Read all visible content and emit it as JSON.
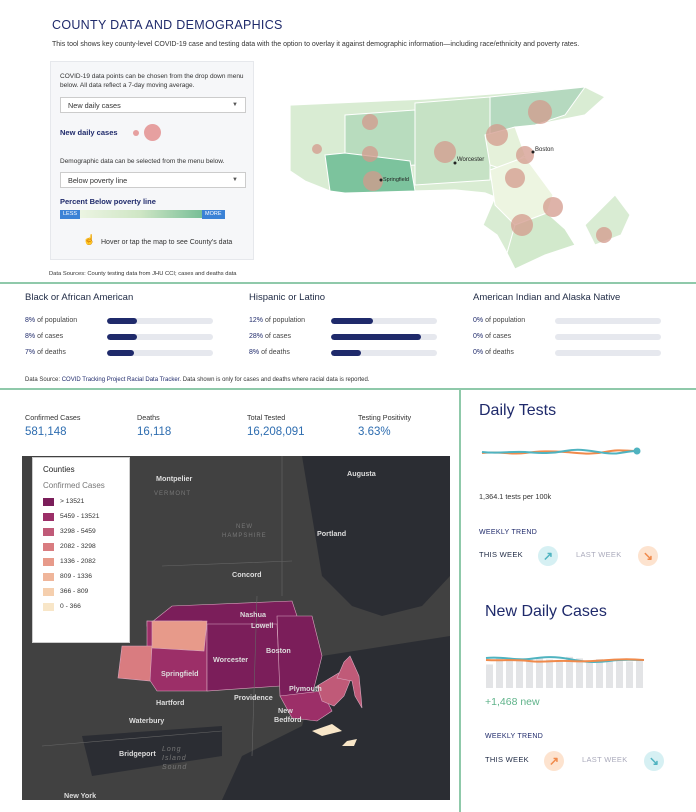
{
  "county": {
    "title": "COUNTY DATA AND DEMOGRAPHICS",
    "intro": "This tool shows key county-level COVID-19 case and testing data with the option to overlay it against demographic information—including race/ethnicity and poverty rates.",
    "covid_help": "COVID-19 data points can be chosen from the drop down menu below. All data reflect a 7-day moving average.",
    "covid_select": "New daily cases",
    "covid_legend": "New daily cases",
    "demo_help": "Demographic data can be selected from the menu below.",
    "demo_select": "Below poverty line",
    "demo_legend": "Percent Below poverty line",
    "less": "LESS",
    "more": "MORE",
    "hover_hint": "Hover or tap the map to see County's data",
    "sources": "Data Sources: County testing data from JHU CCI; cases and deaths data",
    "map_labels": {
      "boston": "Boston",
      "worcester": "Worcester",
      "springfield": "Springfield"
    }
  },
  "race": {
    "groups": [
      {
        "name": "Black or African American",
        "population_pct": "8%",
        "cases_pct": "8%",
        "deaths_pct": "7%",
        "population_val": 8,
        "cases_val": 8,
        "deaths_val": 7
      },
      {
        "name": "Hispanic or Latino",
        "population_pct": "12%",
        "cases_pct": "28%",
        "deaths_pct": "8%",
        "population_val": 12,
        "cases_val": 28,
        "deaths_val": 8
      },
      {
        "name": "American Indian and Alaska Native",
        "population_pct": "0%",
        "cases_pct": "0%",
        "deaths_pct": "0%",
        "population_val": 0,
        "cases_val": 0,
        "deaths_val": 0
      }
    ],
    "lbl_population": "of population",
    "lbl_cases": "of cases",
    "lbl_deaths": "of deaths",
    "source_prefix": "Data Source: ",
    "source_link": "COVID Tracking Project Racial Data Tracker",
    "source_suffix": ". Data shown is only for cases and deaths where racial data is reported."
  },
  "stats": [
    {
      "label": "Confirmed Cases",
      "value": "581,148"
    },
    {
      "label": "Deaths",
      "value": "16,118"
    },
    {
      "label": "Total Tested",
      "value": "16,208,091"
    },
    {
      "label": "Testing Positivity",
      "value": "3.63%"
    }
  ],
  "legend": {
    "title": "Counties",
    "subtitle": "Confirmed Cases",
    "bins": [
      {
        "label": "> 13521",
        "color": "#7b1e5a"
      },
      {
        "label": "5459 - 13521",
        "color": "#9c2f68"
      },
      {
        "label": "3298 - 5459",
        "color": "#c05a78"
      },
      {
        "label": "2082 - 3298",
        "color": "#d97c80"
      },
      {
        "label": "1336 - 2082",
        "color": "#e79a8a"
      },
      {
        "label": "809 - 1336",
        "color": "#efb59a"
      },
      {
        "label": "366 - 809",
        "color": "#f5cfae"
      },
      {
        "label": "0 - 366",
        "color": "#f8e6c8"
      }
    ]
  },
  "dark_map": {
    "cities": {
      "montpelier": "Montpelier",
      "augusta": "Augusta",
      "portland": "Portland",
      "concord": "Concord",
      "nashua": "Nashua",
      "lowell": "Lowell",
      "boston": "Boston",
      "worcester": "Worcester",
      "springfield": "Springfield",
      "plymouth": "Plymouth",
      "providence": "Providence",
      "hartford": "Hartford",
      "new_bedford_1": "New",
      "new_bedford_2": "Bedford",
      "waterbury": "Waterbury",
      "bridgeport": "Bridgeport",
      "new_york": "New York"
    },
    "states": {
      "vermont": "VERMONT",
      "nh_1": "NEW",
      "nh_2": "HAMPSHIRE",
      "li_1": "Long",
      "li_2": "Island",
      "li_3": "Sound"
    }
  },
  "daily_tests": {
    "title": "Daily Tests",
    "per100k": "1,364.1 tests per 100k",
    "weekly_trend": "WEEKLY TREND",
    "this_week": "THIS WEEK",
    "last_week": "LAST WEEK"
  },
  "new_cases": {
    "title": "New Daily Cases",
    "new": "+1,468 new",
    "weekly_trend": "WEEKLY TREND",
    "this_week": "THIS WEEK",
    "last_week": "LAST WEEK",
    "bars": [
      0.62,
      0.8,
      0.78,
      0.78,
      0.75,
      0.8,
      0.75,
      0.7,
      0.82,
      0.78,
      0.7,
      0.76,
      0.72,
      0.75,
      0.7,
      0.72
    ]
  },
  "colors": {
    "navy": "#1f2a6b",
    "teal": "#4fb3c0",
    "orange": "#f08a4b",
    "accent_green": "#8fc9aa"
  }
}
